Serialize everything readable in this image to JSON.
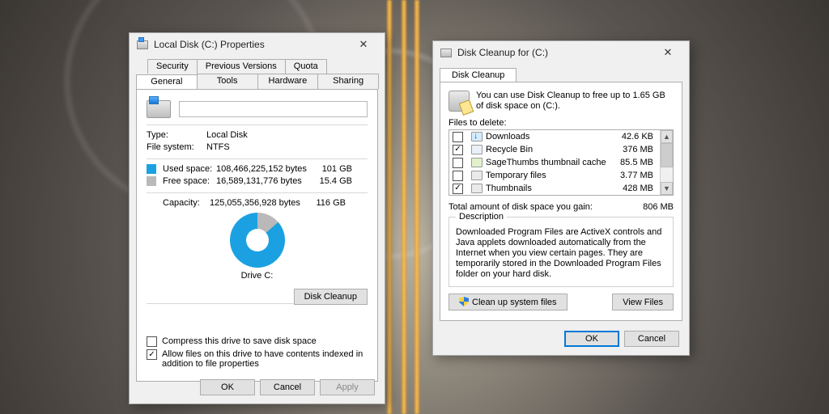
{
  "props": {
    "title": "Local Disk (C:) Properties",
    "tabs_top": [
      "Security",
      "Previous Versions",
      "Quota"
    ],
    "tabs_bot": [
      "General",
      "Tools",
      "Hardware",
      "Sharing"
    ],
    "type_label": "Type:",
    "type_value": "Local Disk",
    "fs_label": "File system:",
    "fs_value": "NTFS",
    "used_label": "Used space:",
    "used_bytes": "108,466,225,152 bytes",
    "used_gb": "101 GB",
    "free_label": "Free space:",
    "free_bytes": "16,589,131,776 bytes",
    "free_gb": "15.4 GB",
    "cap_label": "Capacity:",
    "cap_bytes": "125,055,356,928 bytes",
    "cap_gb": "116 GB",
    "drive_label": "Drive C:",
    "cleanup_btn": "Disk Cleanup",
    "compress": "Compress this drive to save disk space",
    "index": "Allow files on this drive to have contents indexed in addition to file properties",
    "ok": "OK",
    "cancel": "Cancel",
    "apply": "Apply"
  },
  "clean": {
    "title": "Disk Cleanup for  (C:)",
    "tab": "Disk Cleanup",
    "intro": "You can use Disk Cleanup to free up to 1.65 GB of disk space on  (C:).",
    "files_label": "Files to delete:",
    "items": [
      {
        "name": "Downloads",
        "size": "42.6 KB",
        "checked": false,
        "icon": "dl"
      },
      {
        "name": "Recycle Bin",
        "size": "376 MB",
        "checked": true,
        "icon": "rb"
      },
      {
        "name": "SageThumbs thumbnail cache",
        "size": "85.5 MB",
        "checked": false,
        "icon": "st"
      },
      {
        "name": "Temporary files",
        "size": "3.77 MB",
        "checked": false,
        "icon": "pl"
      },
      {
        "name": "Thumbnails",
        "size": "428 MB",
        "checked": true,
        "icon": "pl"
      }
    ],
    "gain_label": "Total amount of disk space you gain:",
    "gain_value": "806 MB",
    "desc_legend": "Description",
    "desc": "Downloaded Program Files are ActiveX controls and Java applets downloaded automatically from the Internet when you view certain pages. They are temporarily stored in the Downloaded Program Files folder on your hard disk.",
    "sys_btn": "Clean up system files",
    "view_btn": "View Files",
    "ok": "OK",
    "cancel": "Cancel"
  }
}
